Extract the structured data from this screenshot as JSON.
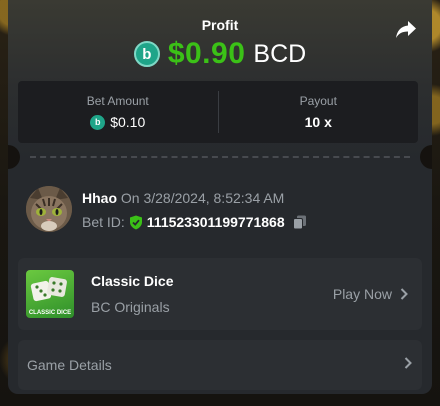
{
  "header": {
    "profit_label": "Profit",
    "profit_amount": "$0.90",
    "profit_currency": "BCD",
    "coin_letter": "b",
    "share_icon": "share-icon"
  },
  "stats": {
    "bet_amount_label": "Bet Amount",
    "bet_amount_value": "$0.10",
    "payout_label": "Payout",
    "payout_value": "10 x"
  },
  "bet": {
    "username": "Hhao",
    "on_text": "On 3/28/2024, 8:52:34 AM",
    "bet_id_label": "Bet ID:",
    "bet_id_value": "111523301199771868"
  },
  "game": {
    "title": "Classic Dice",
    "subtitle": "BC Originals",
    "thumb_text": "CLASSIC DICE",
    "play_label": "Play Now"
  },
  "details": {
    "label": "Game Details"
  },
  "colors": {
    "profit_green": "#3bc117",
    "coin_teal": "#1fa589",
    "verified_green": "#3bc117",
    "card_bg": "#26292d",
    "panel_bg": "#2c2f33"
  }
}
